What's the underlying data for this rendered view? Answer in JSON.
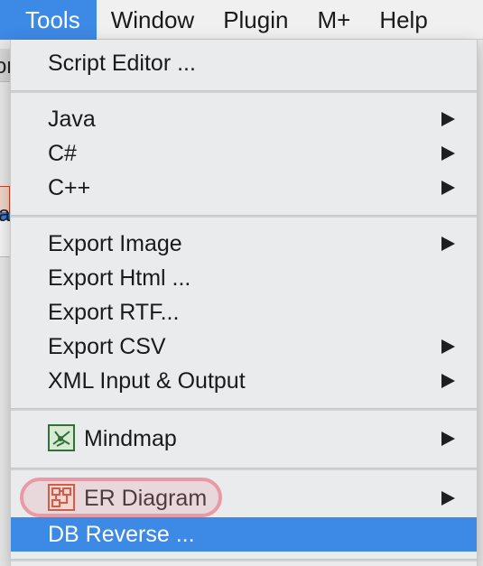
{
  "menubar": {
    "items": [
      {
        "label": "Tools",
        "active": true
      },
      {
        "label": "Window",
        "active": false
      },
      {
        "label": "Plugin",
        "active": false
      },
      {
        "label": "M+",
        "active": false
      },
      {
        "label": "Help",
        "active": false
      }
    ]
  },
  "background": {
    "chars": [
      "or",
      "a"
    ]
  },
  "tools_menu": {
    "script_editor": "Script Editor ...",
    "java": "Java",
    "csharp": "C#",
    "cpp": "C++",
    "export_image": "Export Image",
    "export_html": "Export Html ...",
    "export_rtf": "Export RTF...",
    "export_csv": "Export CSV",
    "xml_io": "XML Input & Output",
    "mindmap": "Mindmap",
    "er_diagram": "ER Diagram",
    "db_reverse": "DB Reverse ..."
  },
  "icons": {
    "mindmap": "mindmap-icon",
    "er_diagram": "er-diagram-icon",
    "submenu": "submenu-arrow-icon"
  },
  "colors": {
    "accent": "#3d89e6",
    "focus_ring": "#e89aa6"
  }
}
